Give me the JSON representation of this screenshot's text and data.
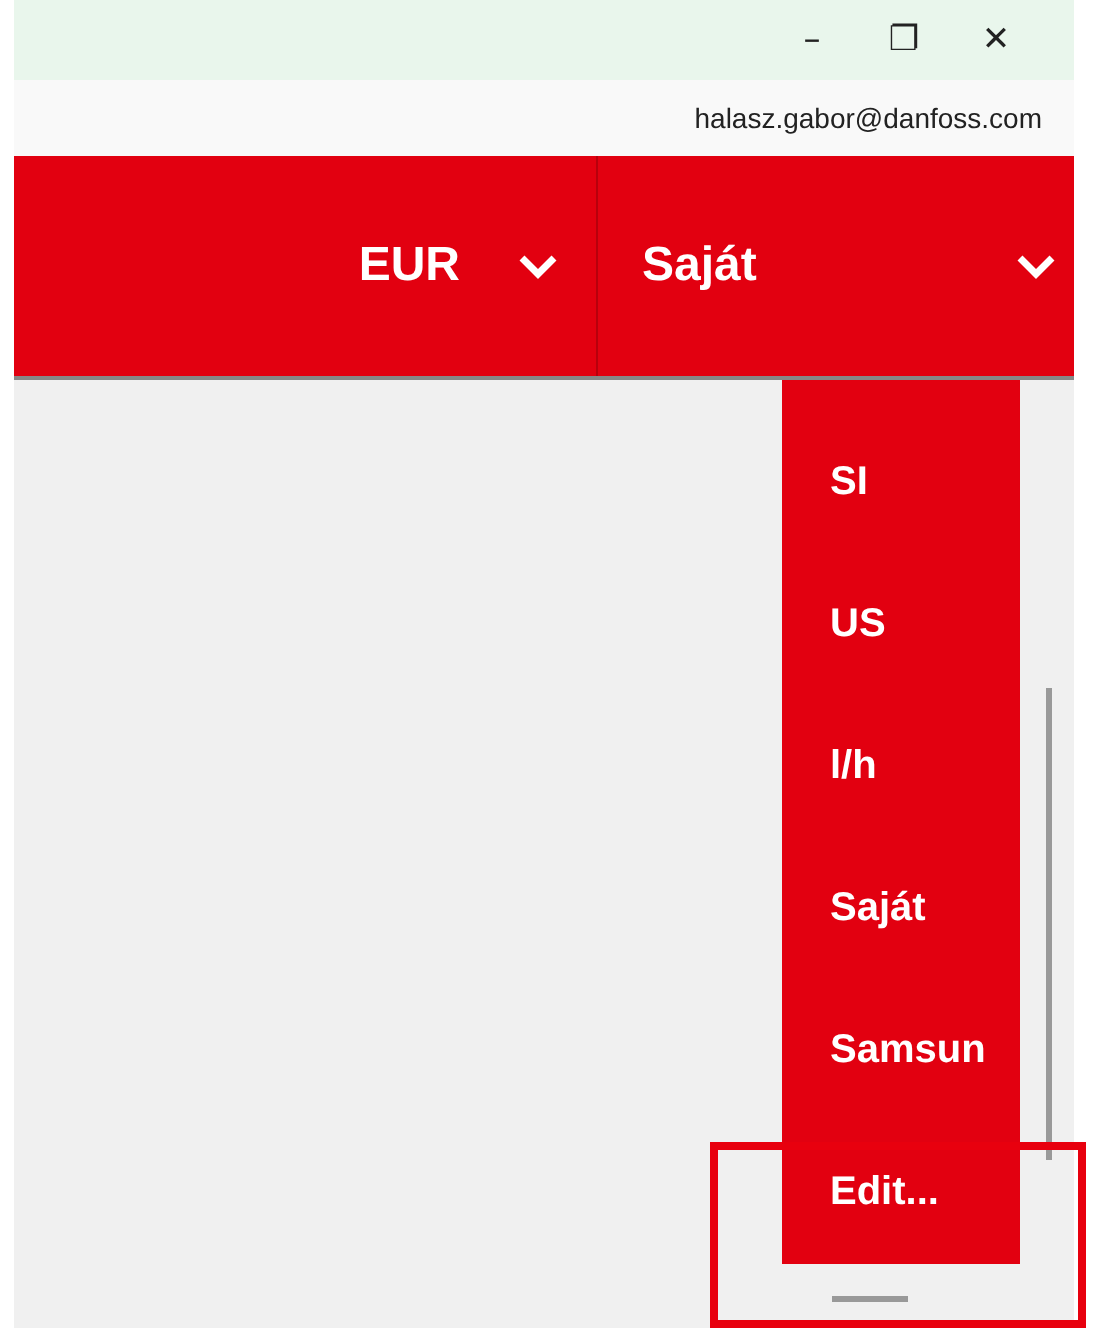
{
  "window": {
    "controls": [
      "–",
      "❐",
      "✕"
    ]
  },
  "account": {
    "email": "halasz.gabor@danfoss.com"
  },
  "header": {
    "currency": {
      "label": "EUR"
    },
    "units": {
      "label": "Saját",
      "expanded": true
    }
  },
  "units_menu": [
    {
      "label": "SI"
    },
    {
      "label": "US"
    },
    {
      "label": "l/h"
    },
    {
      "label": "Saját"
    },
    {
      "label": "Samsun"
    },
    {
      "label": "Edit...",
      "highlighted": true
    }
  ]
}
